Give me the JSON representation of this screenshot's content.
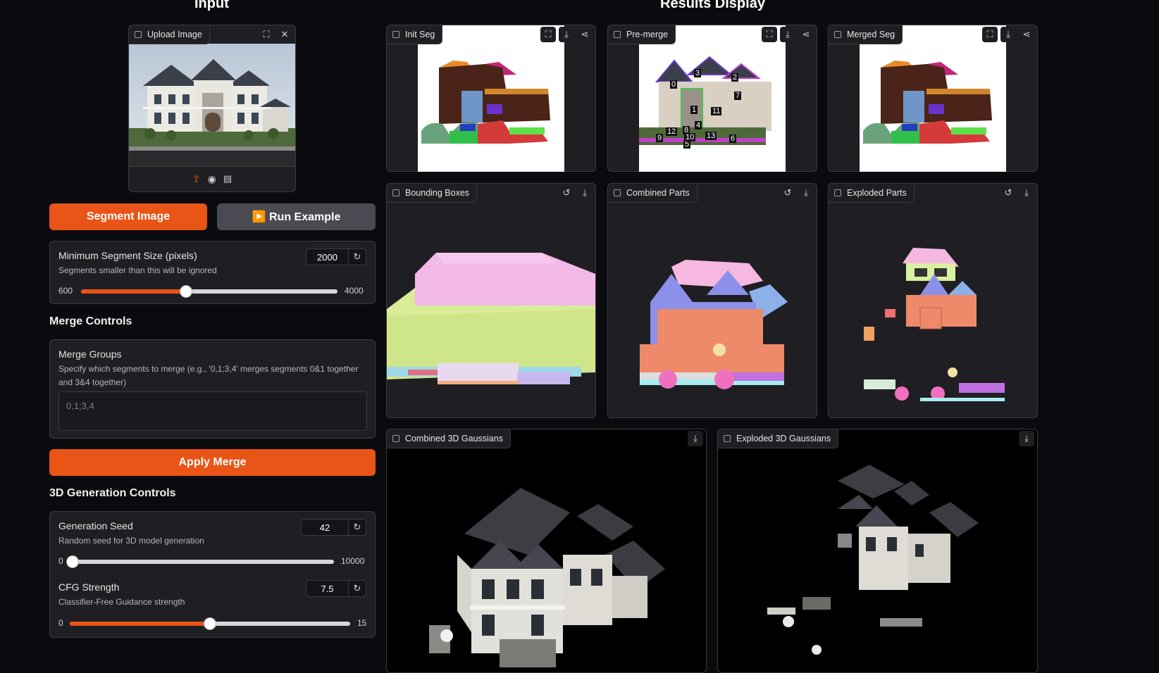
{
  "input": {
    "title": "Input",
    "upload": {
      "label": "Upload Image",
      "icons": [
        "upload-icon",
        "webcam-icon",
        "clipboard-icon"
      ]
    },
    "segment_button": "Segment Image",
    "example_button": "▶️ Run Example",
    "min_segment": {
      "title": "Minimum Segment Size (pixels)",
      "subtitle": "Segments smaller than this will be ignored",
      "value": "2000",
      "min": "600",
      "max": "4000"
    },
    "merge_controls_title": "Merge Controls",
    "merge_groups": {
      "title": "Merge Groups",
      "subtitle": "Specify which segments to merge (e.g., '0,1;3,4' merges segments 0&1 together and 3&4 together)",
      "placeholder": "0,1;3,4"
    },
    "apply_merge_button": "Apply Merge",
    "generation_title": "3D Generation Controls",
    "seed": {
      "title": "Generation Seed",
      "subtitle": "Random seed for 3D model generation",
      "value": "42",
      "min": "0",
      "max": "10000"
    },
    "cfg": {
      "title": "CFG Strength",
      "subtitle": "Classifier-Free Guidance strength",
      "value": "7.5",
      "min": "0",
      "max": "15"
    }
  },
  "results": {
    "title": "Results Display",
    "init_seg": "Init Seg",
    "pre_merge": "Pre-merge",
    "merged_seg": "Merged Seg",
    "bounding_boxes": "Bounding Boxes",
    "combined_parts": "Combined Parts",
    "exploded_parts": "Exploded Parts",
    "combined_gaussians": "Combined 3D Gaussians",
    "exploded_gaussians": "Exploded 3D Gaussians",
    "segment_labels": [
      "0",
      "1",
      "2",
      "3",
      "4",
      "5",
      "6",
      "7",
      "8",
      "9",
      "10",
      "11",
      "12",
      "13"
    ]
  },
  "slider_levels": {
    "min_segment_fraction": 0.41,
    "seed_fraction": 0.0042,
    "cfg_fraction": 0.5
  },
  "colors": {
    "accent": "#e95417",
    "background": "#0b0b0f",
    "panel": "#1f1f23"
  }
}
